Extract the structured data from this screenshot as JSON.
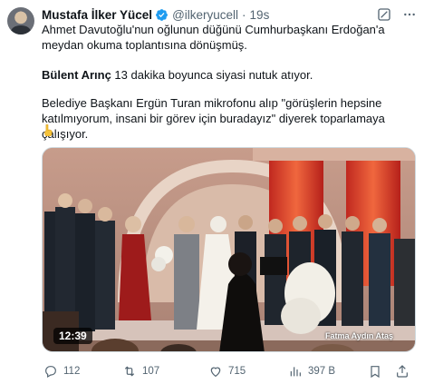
{
  "author": {
    "display_name": "Mustafa İlker Yücel",
    "handle": "@ilkeryucell",
    "separator": "·",
    "time": "19s",
    "verified_color": "#1d9bf0"
  },
  "tweet": {
    "paragraph1": "Ahmet Davutoğlu'nun oğlunun düğünü Cumhurbaşkanı Erdoğan'a meydan okuma toplantısına dönüşmüş.",
    "paragraph2_name": "Bülent Arınç",
    "paragraph2_rest": " 13 dakika boyunca siyasi nutuk atıyor.",
    "paragraph3": "Belediye Başkanı Ergün Turan mikrofonu alıp \"görüşlerin hepsine katılmıyorum, insani bir görev için buradayız\" diyerek toparlamaya çalışıyor.",
    "emoji_icon": "pointing-down-emoji"
  },
  "media": {
    "duration": "12:39",
    "watermark": "Fatma Aydın Ataş"
  },
  "actions": {
    "replies": "112",
    "retweets": "107",
    "likes": "715",
    "views": "397 B"
  },
  "icons": {
    "reply": "reply-icon",
    "retweet": "retweet-icon",
    "like": "heart-icon",
    "views": "views-icon",
    "bookmark": "bookmark-icon",
    "share": "share-icon",
    "grok": "grok-icon",
    "more": "more-icon"
  }
}
